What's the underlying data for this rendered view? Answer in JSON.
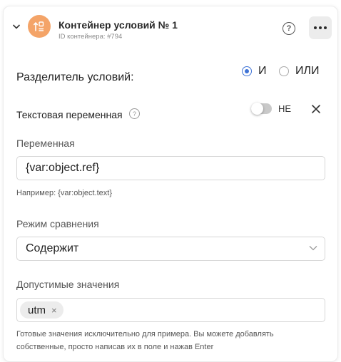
{
  "header": {
    "title": "Контейнер условий № 1",
    "subtitle": "ID контейнера: #794",
    "help_glyph": "?",
    "more_icon": "more-horizontal-icon",
    "icon_color": "#f4a468"
  },
  "separator": {
    "label": "Разделитель условий:",
    "options": [
      {
        "label": "И",
        "selected": true
      },
      {
        "label": "ИЛИ",
        "selected": false
      }
    ]
  },
  "text_variable": {
    "label": "Текстовая переменная",
    "help_glyph": "?",
    "not_label": "НЕ",
    "toggle_on": false
  },
  "variable": {
    "label": "Переменная",
    "value": "{var:object.ref}",
    "hint": "Например: {var:object.text}"
  },
  "compare_mode": {
    "label": "Режим сравнения",
    "value": "Содержит"
  },
  "allowed_values": {
    "label": "Допустимые значения",
    "chips": [
      "utm"
    ],
    "chip_remove": "×",
    "hint_line1": "Готовые значения исключительно для примера. Вы можете добавлять",
    "hint_line2": "собственные, просто написав их в поле и нажав Enter"
  },
  "colors": {
    "accent": "#3f73d6",
    "icon_bg": "#f4a468"
  }
}
